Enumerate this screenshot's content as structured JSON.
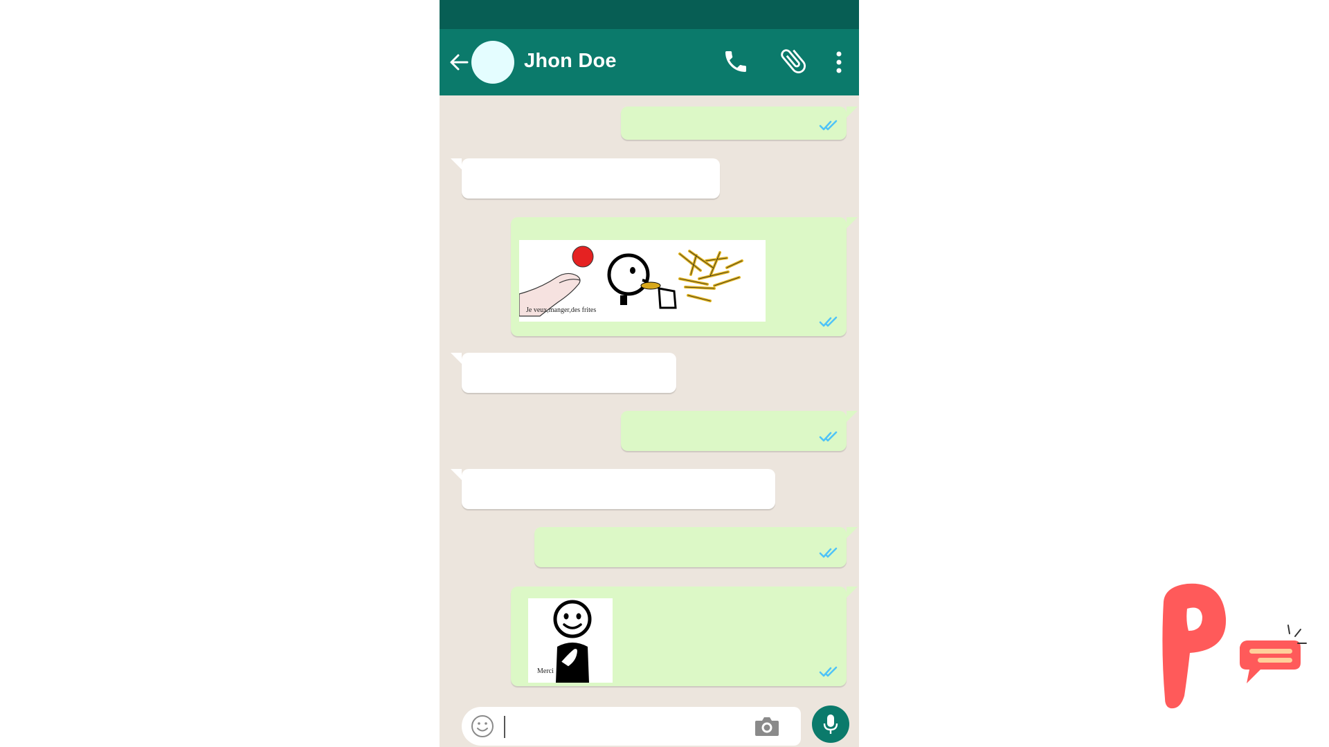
{
  "header": {
    "contact_name": "Jhon Doe",
    "back_icon": "arrow-left-icon",
    "call_icon": "phone-icon",
    "attach_icon": "paperclip-icon",
    "menu_icon": "more-vertical-icon"
  },
  "messages": [
    {
      "direction": "outgoing",
      "type": "text",
      "status": "read"
    },
    {
      "direction": "incoming",
      "type": "text"
    },
    {
      "direction": "outgoing",
      "type": "pictogram",
      "caption": "Je veux,manger,des frites",
      "status": "read"
    },
    {
      "direction": "incoming",
      "type": "text"
    },
    {
      "direction": "outgoing",
      "type": "text",
      "status": "read"
    },
    {
      "direction": "incoming",
      "type": "text"
    },
    {
      "direction": "outgoing",
      "type": "text",
      "status": "read"
    },
    {
      "direction": "outgoing",
      "type": "pictogram",
      "caption": "Merci",
      "status": "read"
    }
  ],
  "composer": {
    "emoji_icon": "smiley-icon",
    "camera_icon": "camera-icon",
    "mic_icon": "microphone-icon"
  },
  "colors": {
    "header": "#0b7a6b",
    "status_bar": "#075e54",
    "chat_background": "#ece5dd",
    "outgoing_bubble": "#dcf8c6",
    "incoming_bubble": "#ffffff",
    "read_check": "#4fc3f7",
    "brand": "#ff5a5a"
  }
}
